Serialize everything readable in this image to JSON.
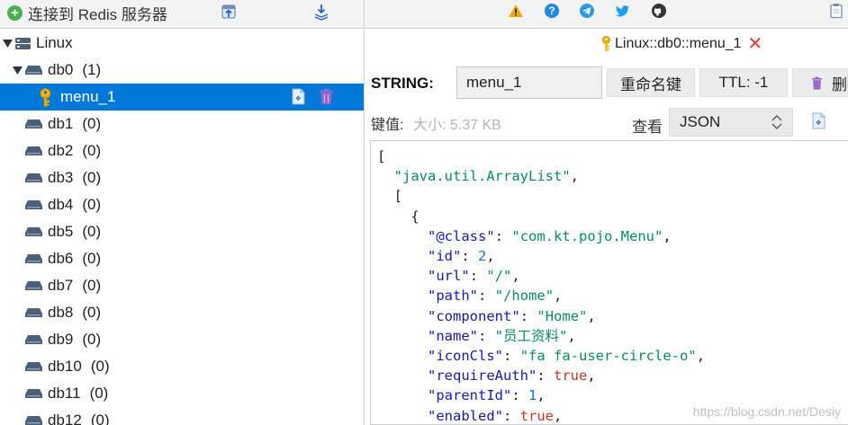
{
  "toolbar": {
    "connect_label": "连接到 Redis 服务器"
  },
  "tree": {
    "server": "Linux",
    "db0": {
      "name": "db0",
      "count": "(1)"
    },
    "key": "menu_1",
    "dbs": [
      {
        "name": "db1",
        "count": "(0)"
      },
      {
        "name": "db2",
        "count": "(0)"
      },
      {
        "name": "db3",
        "count": "(0)"
      },
      {
        "name": "db4",
        "count": "(0)"
      },
      {
        "name": "db5",
        "count": "(0)"
      },
      {
        "name": "db6",
        "count": "(0)"
      },
      {
        "name": "db7",
        "count": "(0)"
      },
      {
        "name": "db8",
        "count": "(0)"
      },
      {
        "name": "db9",
        "count": "(0)"
      },
      {
        "name": "db10",
        "count": "(0)"
      },
      {
        "name": "db11",
        "count": "(0)"
      },
      {
        "name": "db12",
        "count": "(0)"
      }
    ]
  },
  "panel": {
    "tab_title": "Linux::db0::menu_1",
    "type_label": "STRING:",
    "key_value": "menu_1",
    "rename_label": "重命名键",
    "ttl_label": "TTL: -1",
    "delete_label": "删",
    "value_label": "键值:",
    "size_label": "大小: 5.37 KB",
    "view_label": "查看",
    "view_format": "JSON"
  },
  "json_lines": [
    {
      "t": "[",
      "indent": 0
    },
    {
      "key": "java.util.ArrayList",
      "type": "str",
      "indent": 1
    },
    {
      "t": "[",
      "indent": 1
    },
    {
      "t": "{",
      "indent": 2
    },
    {
      "key": "@class",
      "val": "com.kt.pojo.Menu",
      "type": "str",
      "indent": 3
    },
    {
      "key": "id",
      "val": "2",
      "type": "num",
      "indent": 3
    },
    {
      "key": "url",
      "val": "/",
      "type": "str",
      "indent": 3
    },
    {
      "key": "path",
      "val": "/home",
      "type": "str",
      "indent": 3
    },
    {
      "key": "component",
      "val": "Home",
      "type": "str",
      "indent": 3
    },
    {
      "key": "name",
      "val": "员工资料",
      "type": "str",
      "indent": 3
    },
    {
      "key": "iconCls",
      "val": "fa fa-user-circle-o",
      "type": "str",
      "indent": 3
    },
    {
      "key": "requireAuth",
      "val": "true",
      "type": "bool",
      "indent": 3
    },
    {
      "key": "parentId",
      "val": "1",
      "type": "num",
      "indent": 3
    },
    {
      "key": "enabled",
      "val": "true",
      "type": "bool",
      "indent": 3
    }
  ],
  "watermark": "https://blog.csdn.net/Desiy",
  "colors": {
    "selection": "#0078d7",
    "json_string": "#0a8a5f",
    "json_key": "#1a1aa6",
    "json_number": "#1f6fd1",
    "json_bool": "#c0392b",
    "close": "#e53935"
  }
}
